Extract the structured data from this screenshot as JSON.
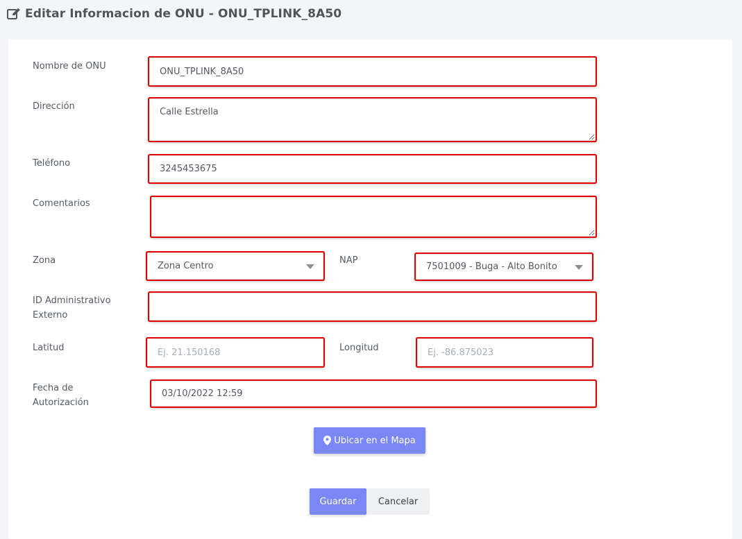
{
  "header": {
    "title": "Editar Informacion de ONU - ONU_TPLINK_8A50",
    "icon": "edit-icon"
  },
  "form": {
    "nombre": {
      "label": "Nombre de ONU",
      "value": "ONU_TPLINK_8A50"
    },
    "direccion": {
      "label": "Dirección",
      "value": "Calle Estrella"
    },
    "telefono": {
      "label": "Teléfono",
      "value": "3245453675"
    },
    "comentarios": {
      "label": "Comentarios",
      "value": ""
    },
    "zona": {
      "label": "Zona",
      "value": "Zona Centro"
    },
    "nap": {
      "label": "NAP",
      "value": "7501009 - Buga - Alto Bonito"
    },
    "id_admin": {
      "label_line1": "ID Administrativo",
      "label_line2": "Externo",
      "value": ""
    },
    "latitud": {
      "label": "Latitud",
      "value": "",
      "placeholder": "Ej. 21.150168"
    },
    "longitud": {
      "label": "Longitud",
      "value": "",
      "placeholder": "Ej. -86.875023"
    },
    "fecha": {
      "label_line1": "Fecha de",
      "label_line2": "Autorización",
      "value": "03/10/2022 12:59"
    }
  },
  "buttons": {
    "map": {
      "label": "Ubicar en el Mapa",
      "icon": "map-marker-icon"
    },
    "save": "Guardar",
    "cancel": "Cancelar"
  },
  "colors": {
    "primary": "#7b87f5",
    "highlight_border": "#e30000",
    "background": "#f3f5f9"
  }
}
